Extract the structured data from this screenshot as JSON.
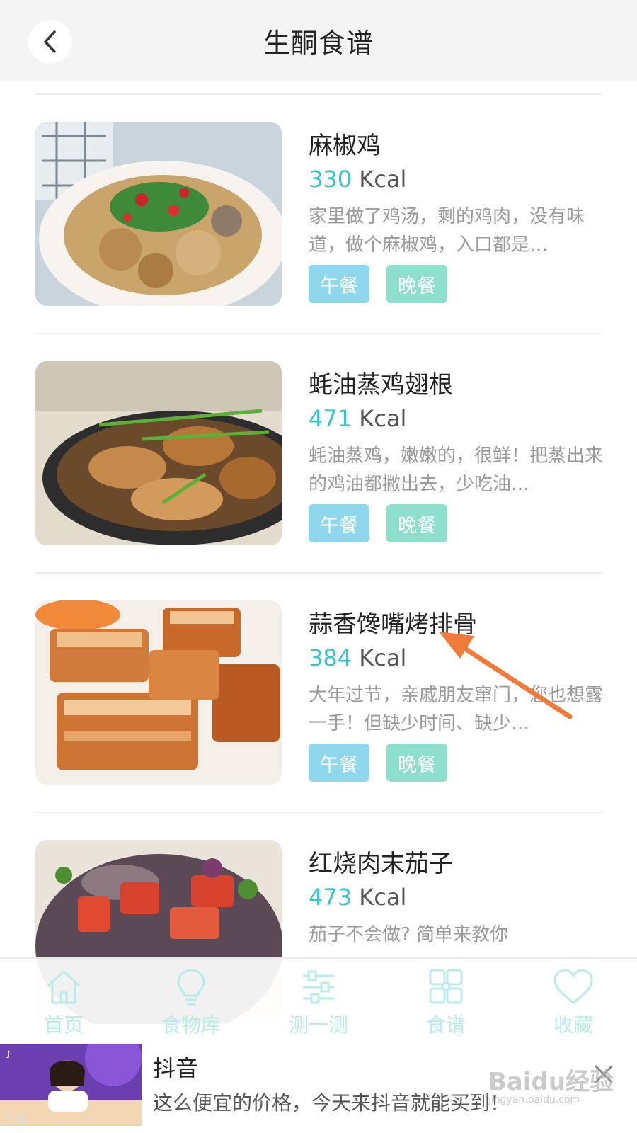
{
  "header": {
    "title": "生酮食谱",
    "back_icon": "chevron-left-icon"
  },
  "recipes": [
    {
      "name": "麻椒鸡",
      "kcal": "330",
      "unit": " Kcal",
      "desc": "家里做了鸡汤，剩的鸡肉，没有味道，做个麻椒鸡，入口都是…",
      "tags": [
        "午餐",
        "晚餐"
      ]
    },
    {
      "name": "蚝油蒸鸡翅根",
      "kcal": "471",
      "unit": " Kcal",
      "desc": "蚝油蒸鸡，嫩嫩的，很鲜！把蒸出来的鸡油都撇出去，少吃油…",
      "tags": [
        "午餐",
        "晚餐"
      ]
    },
    {
      "name": "蒜香馋嘴烤排骨",
      "kcal": "384",
      "unit": " Kcal",
      "desc": "大年过节，亲戚朋友窜门，您也想露一手！但缺少时间、缺少…",
      "tags": [
        "午餐",
        "晚餐"
      ]
    },
    {
      "name": "红烧肉末茄子",
      "kcal": "473",
      "unit": " Kcal",
      "desc": "茄子不会做? 简单来教你",
      "tags": []
    }
  ],
  "bottom_nav": [
    {
      "label": "首页",
      "icon": "home-icon"
    },
    {
      "label": "食物库",
      "icon": "lightbulb-icon"
    },
    {
      "label": "测一测",
      "icon": "sliders-icon"
    },
    {
      "label": "食谱",
      "icon": "grid-icon"
    },
    {
      "label": "收藏",
      "icon": "heart-icon"
    }
  ],
  "ad": {
    "title": "抖音",
    "text": "这么便宜的价格，今天来抖音就能买到！",
    "label": "广告"
  },
  "watermark": {
    "text": "Baidu经验",
    "sub": "jingyan.baidu.com"
  },
  "colors": {
    "kcal_accent": "#39c3c8",
    "tag_lunch": "#8fd8ec",
    "tag_dinner": "#8ee0cd",
    "nav_inactive": "#b7ecea",
    "arrow": "#f07a3a"
  }
}
